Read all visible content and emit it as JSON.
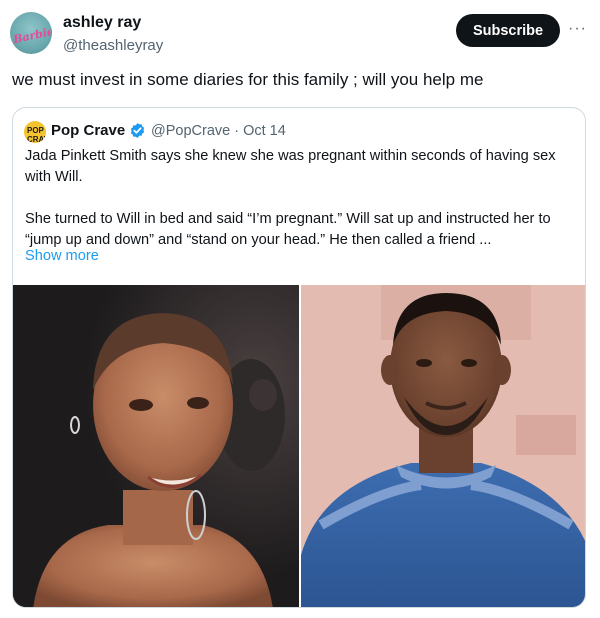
{
  "author": {
    "name": "ashley ray",
    "handle": "@theashleyray",
    "avatar_text": "Barbie",
    "subscribe_label": "Subscribe",
    "more_icon": "···"
  },
  "tweet": {
    "text": "we must invest in some diaries for this family ; will you help me"
  },
  "quote": {
    "avatar_text": "POP CRAVE",
    "name": "Pop Crave",
    "handle": "@PopCrave",
    "date": "Oct 14",
    "paragraph1": "Jada Pinkett Smith says she knew she was pregnant within seconds of having sex with Will.",
    "paragraph2": "She turned to Will in bed and said “I’m pregnant.” Will sat up and instructed her to “jump up and down” and “stand on your head.” He then called a friend ...",
    "show_more": "Show more",
    "images": [
      {
        "name": "jada-photo"
      },
      {
        "name": "will-photo"
      }
    ]
  },
  "colors": {
    "link": "#1d9bf0",
    "secondary_text": "#536471",
    "border": "#cfd9de",
    "verified": "#1d9bf0"
  }
}
